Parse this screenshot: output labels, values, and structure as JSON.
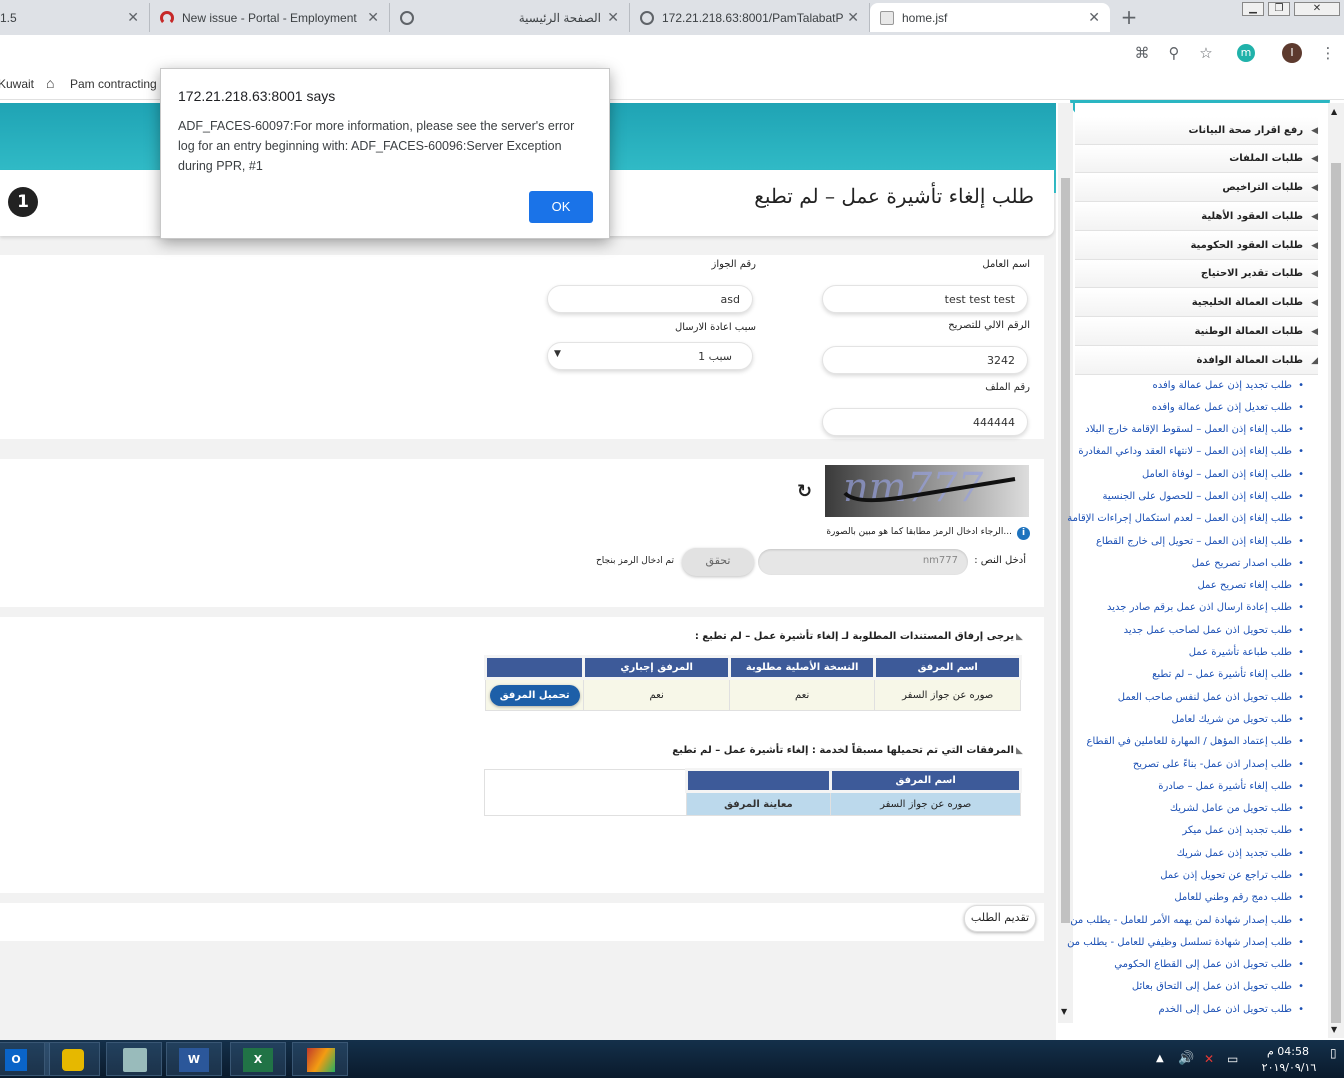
{
  "tabs": [
    {
      "title": "1.5"
    },
    {
      "title": "New issue - Portal - Employment"
    },
    {
      "title": "الصفحة الرئيسية"
    },
    {
      "title": "172.21.218.63:8001/PamTalabatP"
    },
    {
      "title": "home.jsf"
    }
  ],
  "bookmarks": {
    "item1": "Kuwait",
    "item2": "Pam contracting"
  },
  "profile": {
    "badge1": "m",
    "badge2": "I"
  },
  "dialog": {
    "origin": "172.21.218.63:8001 says",
    "message": "ADF_FACES-60097:For more information, please see the server's error log for an entry beginning with: ADF_FACES-60096:Server Exception during PPR, #1",
    "ok": "OK"
  },
  "page": {
    "title": "طلب إلغاء تأشيرة عمل – لم تطبع",
    "step": "1"
  },
  "form": {
    "worker_name_label": "اسم العامل",
    "worker_name_value": "test test test",
    "passport_label": "رقم الجواز",
    "passport_value": "asd",
    "permit_no_label": "الرقم الالي للتصريح",
    "permit_no_value": "3242",
    "resend_reason_label": "سبب اعادة الارسال",
    "resend_reason_value": "سبب 1",
    "file_no_label": "رقم الملف",
    "file_no_value": "444444"
  },
  "captcha": {
    "image_text": "nm777",
    "hint": "...الرجاء ادخال الرمز مطابقا كما هو مبين بالصورة",
    "input_label": "أدخل النص :",
    "input_value": "nm777",
    "verify_button": "تحقق",
    "success_msg": "تم ادخال الرمز بنجاح"
  },
  "attachments": {
    "heading": "يرجى إرفاق المستندات المطلوبة لـ إلغاء تأشيرة عمل – لم تطبع :",
    "columns": [
      "اسم المرفق",
      "النسخة الأصلية مطلوبة",
      "المرفق إجباري",
      ""
    ],
    "rows": [
      {
        "name": "صوره عن جواز السفر",
        "original": "نعم",
        "mandatory": "نعم",
        "action": "تحميل المرفق"
      }
    ]
  },
  "previous": {
    "heading": "المرفقات التي تم تحميلها مسبقاً لخدمة : إلغاء تأشيرة عمل – لم تطبع",
    "columns": [
      "اسم المرفق",
      ""
    ],
    "rows": [
      {
        "name": "صوره عن جواز السفر",
        "action": "معاينة المرفق"
      }
    ]
  },
  "submit_button": "تقديم الطلب",
  "sidebar": {
    "sections": [
      "رفع اقرار صحة البيانات",
      "طلبات الملفات",
      "طلبات التراخيص",
      "طلبات العقود الأهلية",
      "طلبات العقود الحكومية",
      "طلبات تقدير الاحتياج",
      "طلبات العمالة الخليجية",
      "طلبات العمالة الوطنية",
      "طلبات العمالة الوافدة"
    ],
    "items": [
      "طلب تجديد إذن عمل عمالة وافده",
      "طلب تعديل إذن عمل عمالة وافده",
      "طلب إلغاء إذن العمل – لسقوط الإقامة خارج البلاد",
      "طلب إلغاء إذن العمل – لانتهاء العقد وداعي المغادرة",
      "طلب إلغاء إذن العمل – لوفاة العامل",
      "طلب إلغاء إذن العمل – للحصول على الجنسية",
      "طلب إلغاء إذن العمل – لعدم استكمال إجراءات الإقامة",
      "طلب إلغاء إذن العمل – تحويل إلى خارج القطاع",
      "طلب اصدار تصريح عمل",
      "طلب إلغاء تصريح عمل",
      "طلب إعادة ارسال اذن عمل برقم صادر جديد",
      "طلب تحويل اذن عمل لصاحب عمل جديد",
      "طلب طباعة تأشيرة عمل",
      "طلب إلغاء تأشيرة عمل – لم تطبع",
      "طلب تحويل اذن عمل لنفس صاحب العمل",
      "طلب تحويل من شريك لعامل",
      "طلب إعتماد المؤهل / المهارة للعاملين في القطاع",
      "طلب إصدار اذن عمل- بناءً على تصريح",
      "طلب إلغاء تأشيرة عمل – صادرة",
      "طلب تحويل من عامل لشريك",
      "طلب تجديد إذن عمل ميكر",
      "طلب تجديد إذن عمل شريك",
      "طلب تراجع عن تحويل إذن عمل",
      "طلب دمج رقم وطني للعامل",
      "طلب إصدار شهادة لمن يهمه الأمر للعامل - يطلب من",
      "طلب إصدار شهادة تسلسل وظيفي للعامل - يطلب من",
      "طلب تحويل اذن عمل إلى القطاع الحكومي",
      "طلب تحويل اذن عمل إلى التحاق بعائل",
      "طلب تحويل اذن عمل إلى الخدم"
    ]
  },
  "clock": {
    "time": "04:58 م",
    "date": "٢٠١٩/٠٩/١٦"
  }
}
